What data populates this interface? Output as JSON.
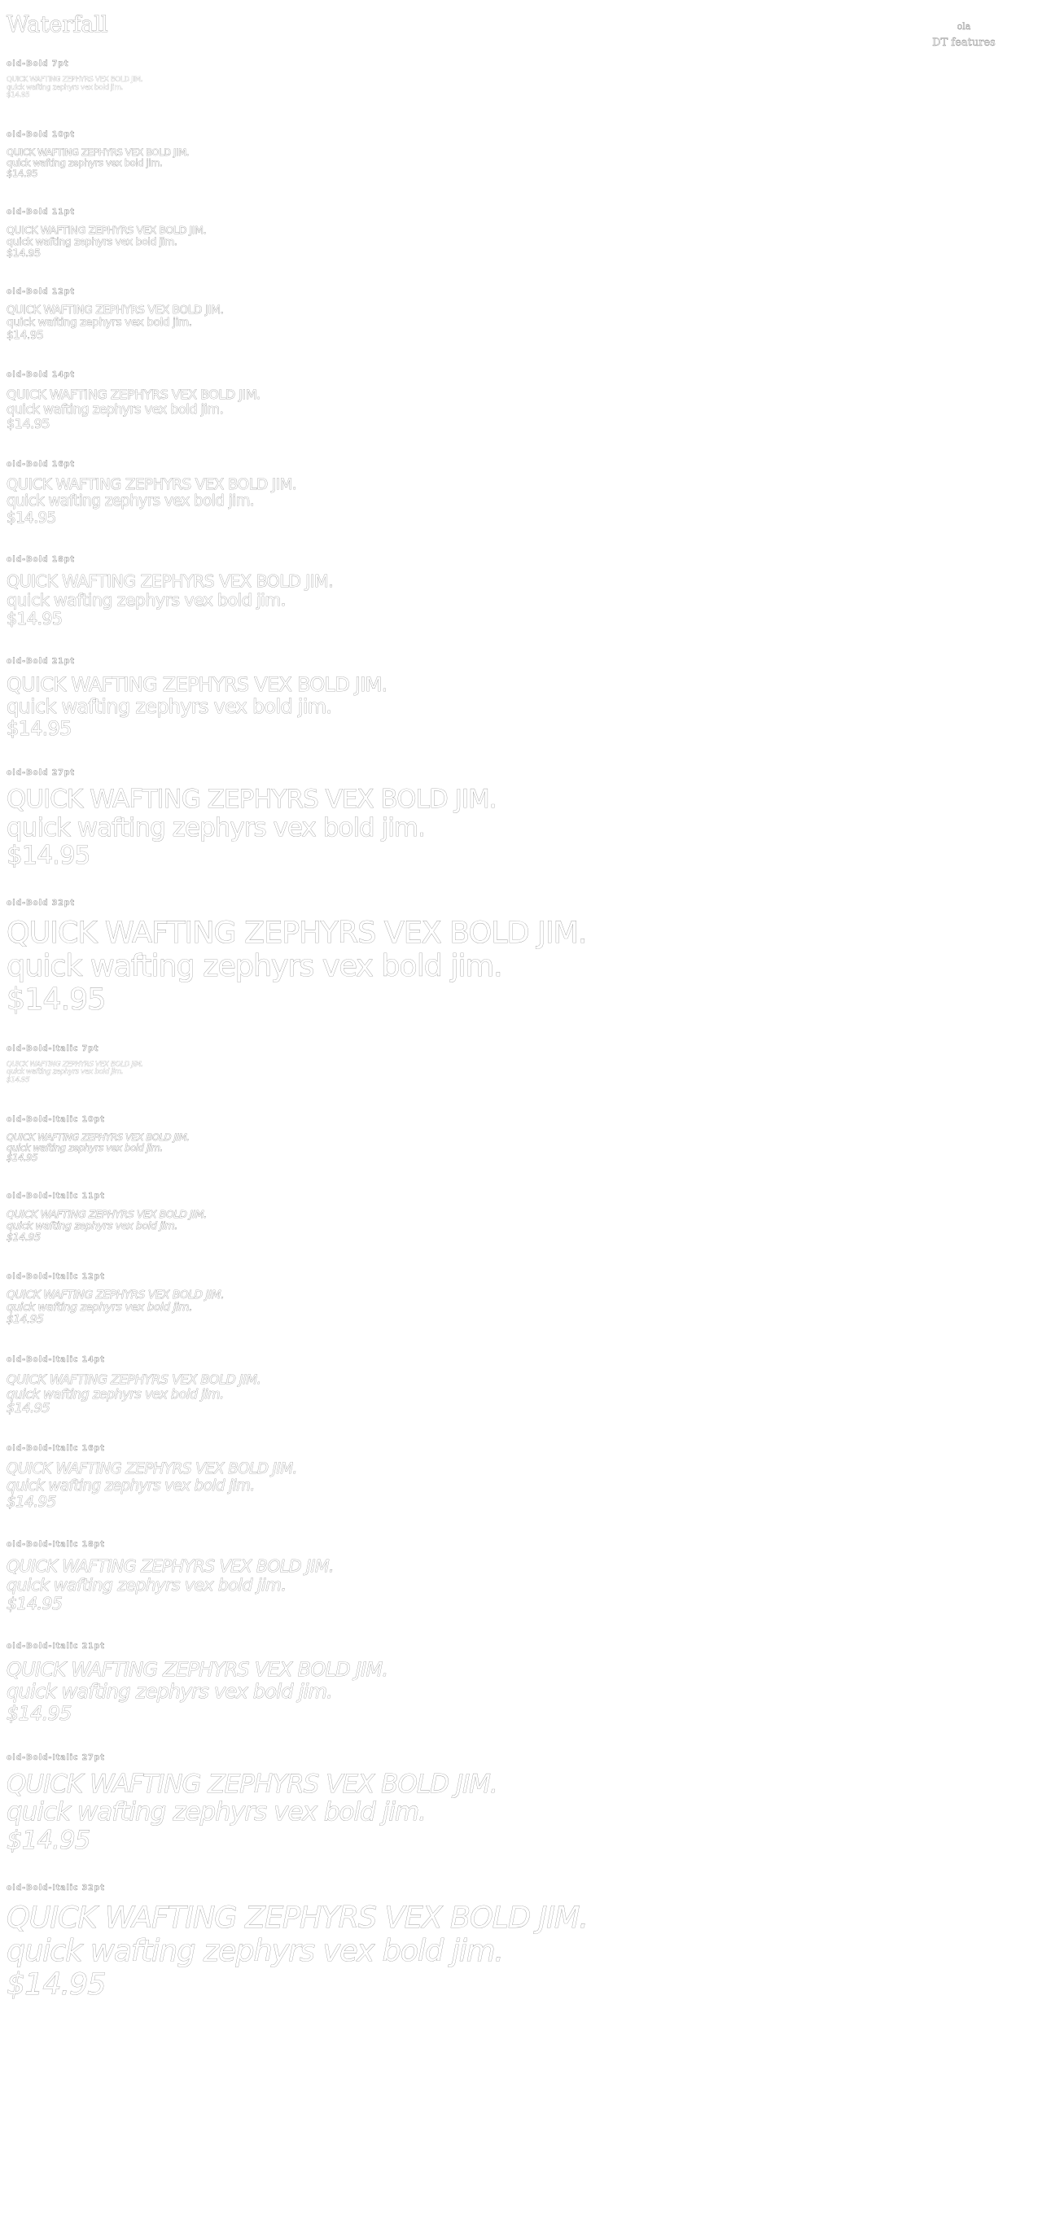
{
  "header": {
    "title": "Waterfall",
    "font_name": "ola",
    "features_label": "DT features"
  },
  "sample_text": {
    "upper": "QUICK WAFTING ZEPHYRS VEX BOLD JIM.",
    "lower": "quick wafting zephyrs vex bold jim.",
    "price": "$14.95"
  },
  "sections": [
    {
      "label": "old-Bold 7pt",
      "size_pt": 7,
      "italic": false
    },
    {
      "label": "old-Bold 10pt",
      "size_pt": 10,
      "italic": false
    },
    {
      "label": "old-Bold 11pt",
      "size_pt": 11,
      "italic": false
    },
    {
      "label": "old-Bold 12pt",
      "size_pt": 12,
      "italic": false
    },
    {
      "label": "old-Bold 14pt",
      "size_pt": 14,
      "italic": false
    },
    {
      "label": "old-Bold 16pt",
      "size_pt": 16,
      "italic": false
    },
    {
      "label": "old-Bold 18pt",
      "size_pt": 18,
      "italic": false
    },
    {
      "label": "old-Bold 21pt",
      "size_pt": 21,
      "italic": false
    },
    {
      "label": "old-Bold 27pt",
      "size_pt": 27,
      "italic": false
    },
    {
      "label": "old-Bold 32pt",
      "size_pt": 32,
      "italic": false
    },
    {
      "label": "old-Bold-Italic 7pt",
      "size_pt": 7,
      "italic": true
    },
    {
      "label": "old-Bold-Italic 10pt",
      "size_pt": 10,
      "italic": true
    },
    {
      "label": "old-Bold-Italic 11pt",
      "size_pt": 11,
      "italic": true
    },
    {
      "label": "old-Bold-Italic 12pt",
      "size_pt": 12,
      "italic": true
    },
    {
      "label": "old-Bold-Italic 14pt",
      "size_pt": 14,
      "italic": true
    },
    {
      "label": "old-Bold-Italic 16pt",
      "size_pt": 16,
      "italic": true
    },
    {
      "label": "old-Bold-Italic 18pt",
      "size_pt": 18,
      "italic": true
    },
    {
      "label": "old-Bold-Italic 21pt",
      "size_pt": 21,
      "italic": true
    },
    {
      "label": "old-Bold-Italic 27pt",
      "size_pt": 27,
      "italic": true
    },
    {
      "label": "old-Bold-Italic 32pt",
      "size_pt": 32,
      "italic": true
    }
  ]
}
